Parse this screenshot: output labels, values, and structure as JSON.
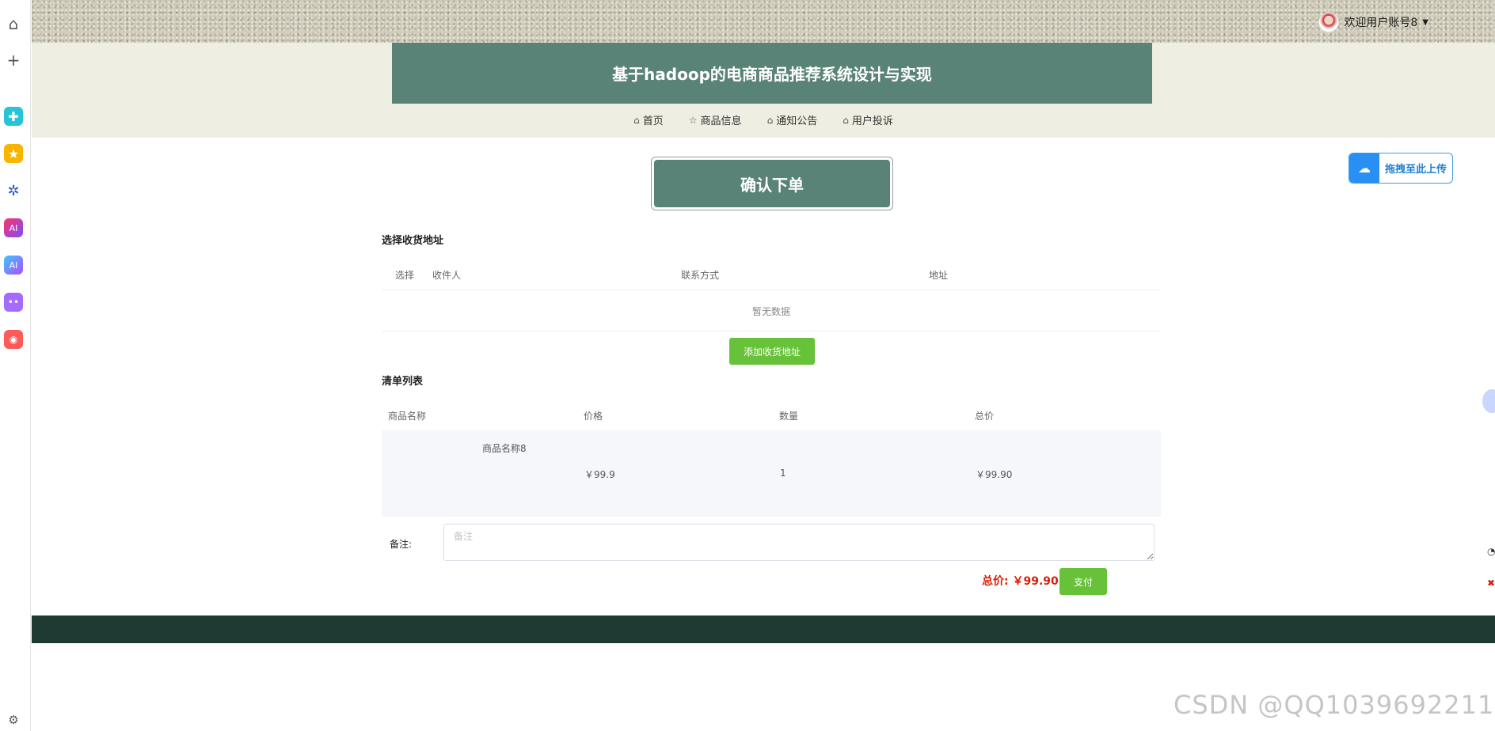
{
  "welcome_text": "欢迎用户账号8",
  "site_title": "基于hadoop的电商商品推荐系统设计与实现",
  "nav": [
    {
      "label": "首页",
      "icon": "home-icon"
    },
    {
      "label": "商品信息",
      "icon": "star-icon"
    },
    {
      "label": "通知公告",
      "icon": "bell-icon"
    },
    {
      "label": "用户投诉",
      "icon": "home-icon"
    }
  ],
  "upload_label": "拖拽至此上传",
  "page_heading": "确认下单",
  "address_section": {
    "title": "选择收货地址",
    "headers": [
      "选择",
      "收件人",
      "联系方式",
      "地址"
    ],
    "empty_text": "暂无数据",
    "add_button": "添加收货地址"
  },
  "order_section": {
    "title": "清单列表",
    "headers": [
      "商品名称",
      "价格",
      "数量",
      "总价"
    ],
    "items": [
      {
        "name": "商品名称8",
        "price": "￥99.9",
        "quantity": "1",
        "total": "￥99.90"
      }
    ]
  },
  "remark": {
    "label": "备注:",
    "placeholder": "备注",
    "value": ""
  },
  "total_label": "总价:",
  "total_value": "￥99.90",
  "pay_button": "支付",
  "watermark": "CSDN @QQ1039692211",
  "colors": {
    "brand": "#5a8377",
    "footer": "#1f3a32",
    "success": "#67c23a",
    "price": "#d81e06"
  }
}
